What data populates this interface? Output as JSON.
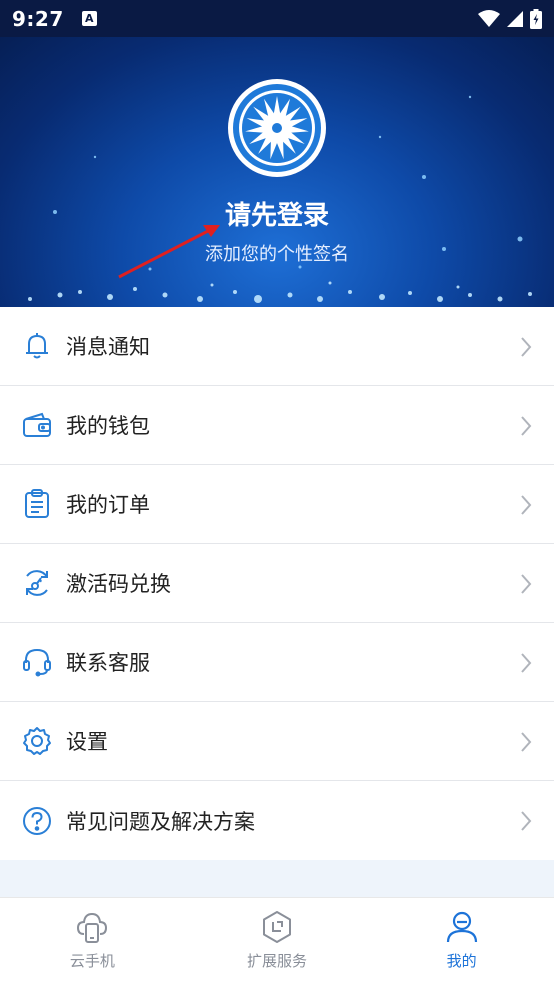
{
  "status_bar": {
    "time": "9:27",
    "notification_icon": "A",
    "icons": [
      "wifi-icon",
      "signal-icon",
      "battery-icon"
    ]
  },
  "header": {
    "title": "请先登录",
    "subtitle": "添加您的个性签名",
    "logo_icon": "flower-logo-icon",
    "annotation": "red-arrow"
  },
  "menu": {
    "items": [
      {
        "label": "消息通知",
        "icon": "bell-icon"
      },
      {
        "label": "我的钱包",
        "icon": "wallet-icon"
      },
      {
        "label": "我的订单",
        "icon": "clipboard-icon"
      },
      {
        "label": "激活码兑换",
        "icon": "key-exchange-icon"
      },
      {
        "label": "联系客服",
        "icon": "headset-icon"
      },
      {
        "label": "设置",
        "icon": "gear-icon"
      },
      {
        "label": "常见问题及解决方案",
        "icon": "help-icon"
      }
    ]
  },
  "tabbar": {
    "tabs": [
      {
        "label": "云手机",
        "icon": "cloud-phone-icon",
        "active": false
      },
      {
        "label": "扩展服务",
        "icon": "expand-service-icon",
        "active": false
      },
      {
        "label": "我的",
        "icon": "profile-icon",
        "active": true
      }
    ]
  },
  "colors": {
    "accent": "#1d73d8",
    "icon_blue": "#2a7fd6",
    "annotation_red": "#e02020"
  }
}
